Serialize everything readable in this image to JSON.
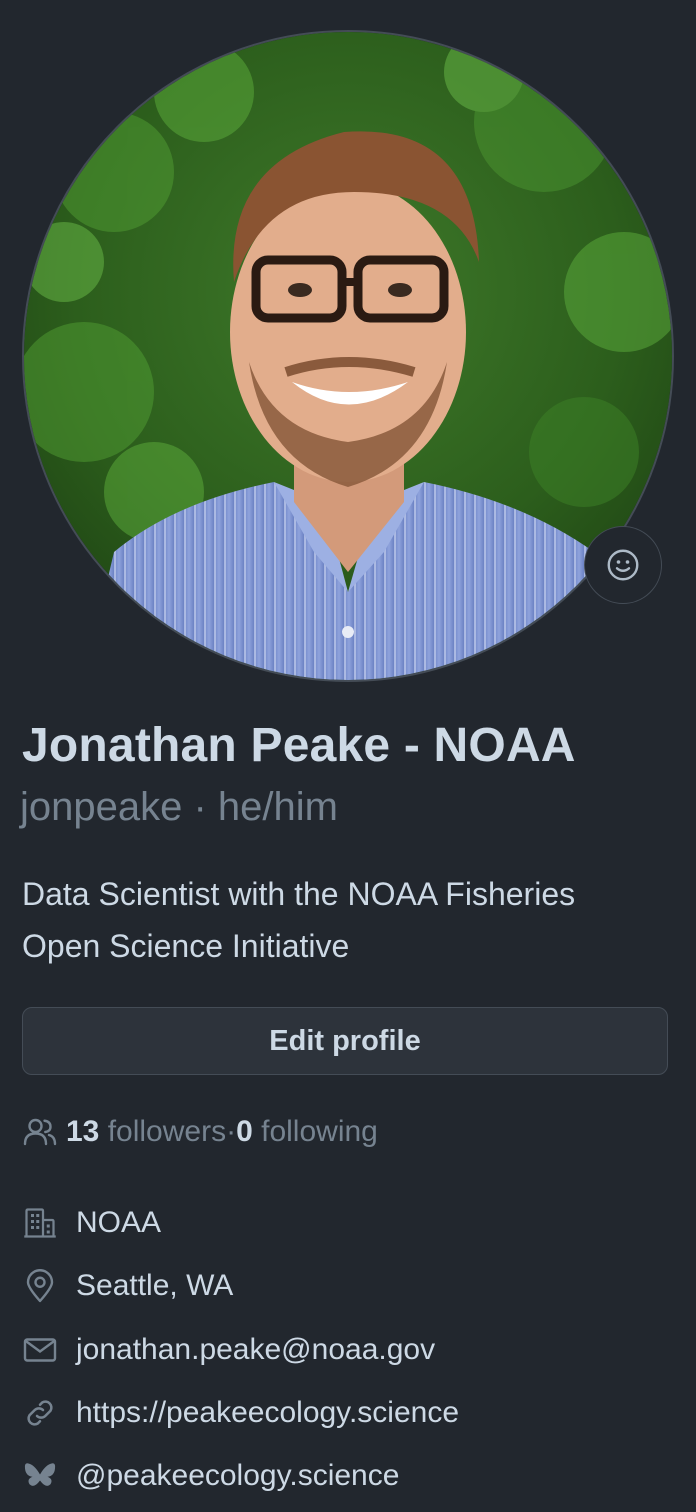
{
  "profile": {
    "full_name": "Jonathan Peake - NOAA",
    "login": "jonpeake",
    "separator": " · ",
    "pronouns": "he/him",
    "bio": "Data Scientist with the NOAA Fisheries Open Science Initiative",
    "avatar_icon": "profile-photo",
    "status_icon": "smiley-icon"
  },
  "actions": {
    "edit_label": "Edit profile"
  },
  "social": {
    "followers_count": "13",
    "followers_label": " followers",
    "separator": " · ",
    "following_count": "0",
    "following_label": " following"
  },
  "details": {
    "organization": "NOAA",
    "location": "Seattle, WA",
    "email": "jonathan.peake@noaa.gov",
    "website": "https://peakeecology.science",
    "bluesky": "@peakeecology.science"
  },
  "colors": {
    "background": "#22272e",
    "text_primary": "#cdd9e5",
    "text_muted": "#768390",
    "border": "#444c56",
    "button_bg": "#2d333b"
  }
}
